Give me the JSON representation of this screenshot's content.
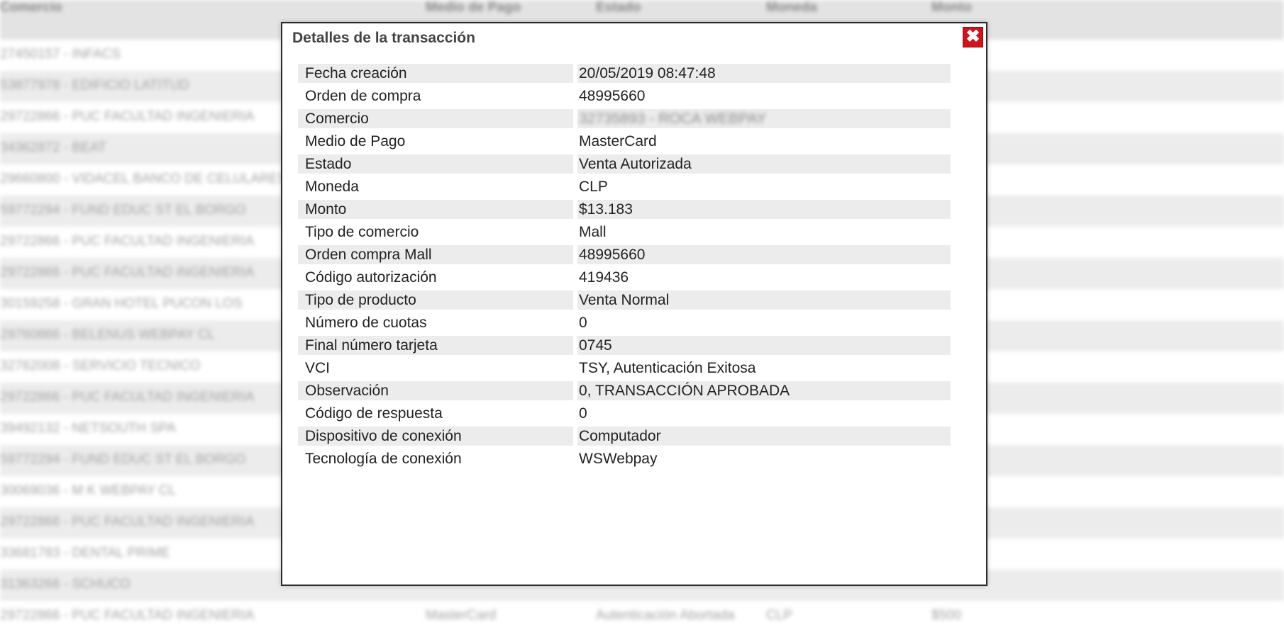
{
  "background": {
    "headers": [
      "Comercio",
      "Medio de Pago",
      "Estado",
      "Moneda",
      "Monto"
    ],
    "rows": [
      [
        "27450157 - INFACS",
        "",
        "",
        "",
        ""
      ],
      [
        "53877978 - EDIFICIO LATITUD",
        "",
        "",
        "",
        ""
      ],
      [
        "29722866 - PUC FACULTAD INGENIERIA",
        "",
        "",
        "",
        ""
      ],
      [
        "34362872 - BEAT",
        "",
        "",
        "",
        ""
      ],
      [
        "29660800 - VIDACEL BANCO DE CELULARES",
        "",
        "",
        "",
        ""
      ],
      [
        "59772294 - FUND EDUC ST EL BORGO",
        "",
        "",
        "",
        ""
      ],
      [
        "29722866 - PUC FACULTAD INGENIERIA",
        "",
        "",
        "",
        ""
      ],
      [
        "29722866 - PUC FACULTAD INGENIERIA",
        "",
        "",
        "",
        ""
      ],
      [
        "30159258 - GRAN HOTEL PUCON LOS",
        "",
        "",
        "",
        ""
      ],
      [
        "29760866 - BELENUS WEBPAY CL",
        "",
        "",
        "",
        ""
      ],
      [
        "32762008 - SERVICIO TECNICO",
        "",
        "",
        "",
        ""
      ],
      [
        "29722866 - PUC FACULTAD INGENIERIA",
        "",
        "",
        "",
        ""
      ],
      [
        "39492132 - NETSOUTH SPA",
        "",
        "",
        "",
        ""
      ],
      [
        "59772294 - FUND EDUC ST EL BORGO",
        "",
        "",
        "",
        ""
      ],
      [
        "30069036 - M K WEBPAY CL",
        "",
        "",
        "",
        ""
      ],
      [
        "29722866 - PUC FACULTAD INGENIERIA",
        "",
        "",
        "",
        ""
      ],
      [
        "33681783 - DENTAL PRIME",
        "",
        "",
        "",
        ""
      ],
      [
        "31363266 - SCHUCO",
        "",
        "",
        "",
        ""
      ],
      [
        "29722866 - PUC FACULTAD INGENIERIA",
        "MasterCard",
        "Autenticación Abortada",
        "CLP",
        "$500"
      ]
    ]
  },
  "modal": {
    "title": "Detalles de la transacción",
    "close_icon": "close-icon",
    "close_symbol": "✖",
    "details": [
      {
        "label": "Fecha creación",
        "value": "20/05/2019 08:47:48"
      },
      {
        "label": "Orden de compra",
        "value": "48995660"
      },
      {
        "label": "Comercio",
        "value": "32735893 - ROCA WEBPAY",
        "blurred": true
      },
      {
        "label": "Medio de Pago",
        "value": "MasterCard"
      },
      {
        "label": "Estado",
        "value": "Venta Autorizada"
      },
      {
        "label": "Moneda",
        "value": "CLP"
      },
      {
        "label": "Monto",
        "value": "$13.183"
      },
      {
        "label": "Tipo de comercio",
        "value": "Mall"
      },
      {
        "label": "Orden compra Mall",
        "value": "48995660"
      },
      {
        "label": "Código autorización",
        "value": "419436"
      },
      {
        "label": "Tipo de producto",
        "value": "Venta Normal"
      },
      {
        "label": "Número de cuotas",
        "value": "0"
      },
      {
        "label": "Final número tarjeta",
        "value": "0745"
      },
      {
        "label": "VCI",
        "value": "TSY, Autenticación Exitosa"
      },
      {
        "label": "Observación",
        "value": "0, TRANSACCIÓN APROBADA"
      },
      {
        "label": "Código de respuesta",
        "value": "0"
      },
      {
        "label": "Dispositivo de conexión",
        "value": "Computador"
      },
      {
        "label": "Tecnología de conexión",
        "value": "WSWebpay"
      }
    ]
  },
  "colors": {
    "close_button": "#d0141b",
    "row_shade": "#ececec",
    "title_text": "#444444"
  }
}
